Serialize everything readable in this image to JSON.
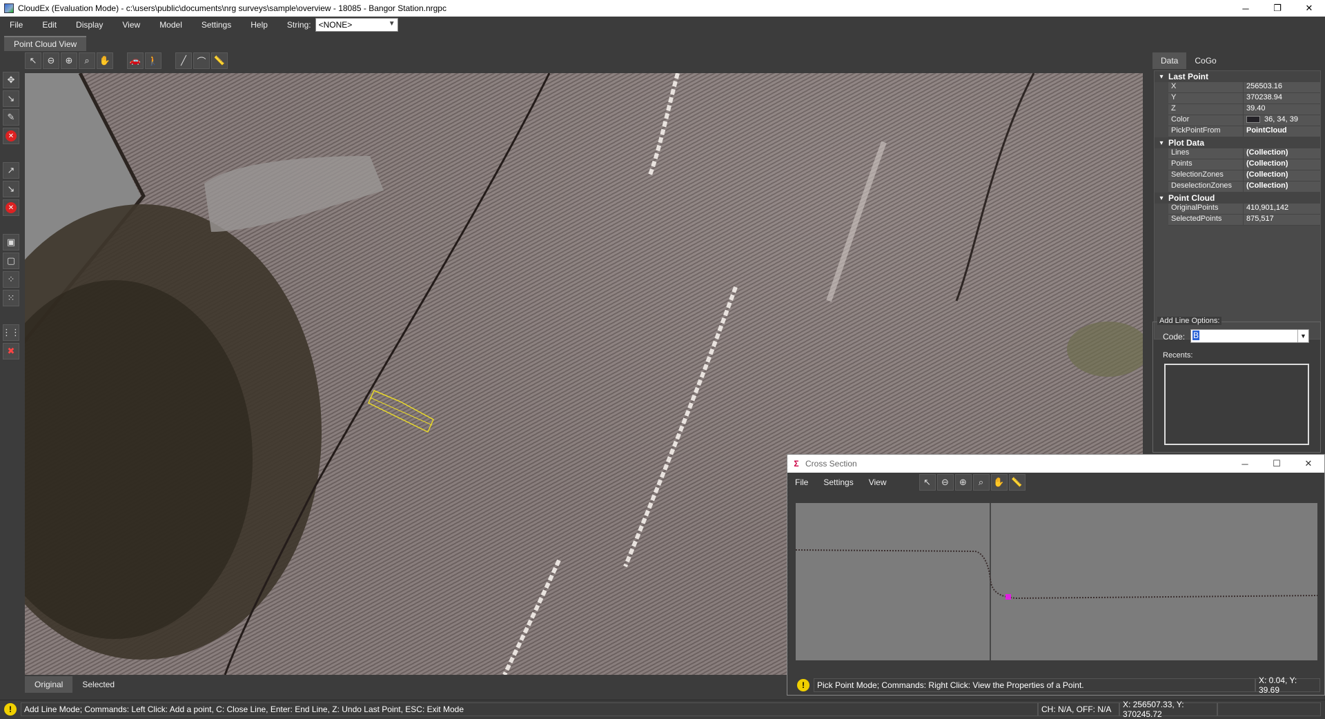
{
  "window": {
    "title": "CloudEx (Evaluation Mode) - c:\\users\\public\\documents\\nrg surveys\\sample\\overview - 18085 - Bangor Station.nrgpc"
  },
  "menu": [
    "File",
    "Edit",
    "Display",
    "View",
    "Model",
    "Settings",
    "Help"
  ],
  "string": {
    "label": "String:",
    "value": "<NONE>"
  },
  "doc_tab": "Point Cloud View",
  "view_tabs": [
    "Original",
    "Selected"
  ],
  "status": {
    "message": "Add Line Mode; Commands: Left Click: Add a point, C: Close Line, Enter: End Line, Z: Undo Last Point, ESC: Exit Mode",
    "ch": "CH: N/A, OFF: N/A",
    "xy": "X: 256507.33, Y: 370245.72"
  },
  "right_panel": {
    "tabs": [
      "Data",
      "CoGo"
    ],
    "last_point": {
      "label": "Last Point",
      "x_k": "X",
      "x": "256503.16",
      "y_k": "Y",
      "y": "370238.94",
      "z_k": "Z",
      "z": "39.40",
      "color_k": "Color",
      "color": "36, 34, 39",
      "pick_k": "PickPointFrom",
      "pick": "PointCloud"
    },
    "plot_data": {
      "label": "Plot Data",
      "lines_k": "Lines",
      "lines": "(Collection)",
      "points_k": "Points",
      "points": "(Collection)",
      "sel_k": "SelectionZones",
      "sel": "(Collection)",
      "desel_k": "DeselectionZones",
      "desel": "(Collection)"
    },
    "point_cloud": {
      "label": "Point Cloud",
      "orig_k": "OriginalPoints",
      "orig": "410,901,142",
      "selpts_k": "SelectedPoints",
      "selpts": "875,517"
    }
  },
  "add_line": {
    "legend": "Add Line Options:",
    "code_label": "Code:",
    "code_value": "B",
    "recents_label": "Recents:"
  },
  "cross_section": {
    "title": "Cross Section",
    "menu": [
      "File",
      "Settings",
      "View"
    ],
    "status": "Pick Point Mode; Commands: Right Click: View the Properties of a Point.",
    "coords": "X: 0.04, Y: 39.69"
  }
}
